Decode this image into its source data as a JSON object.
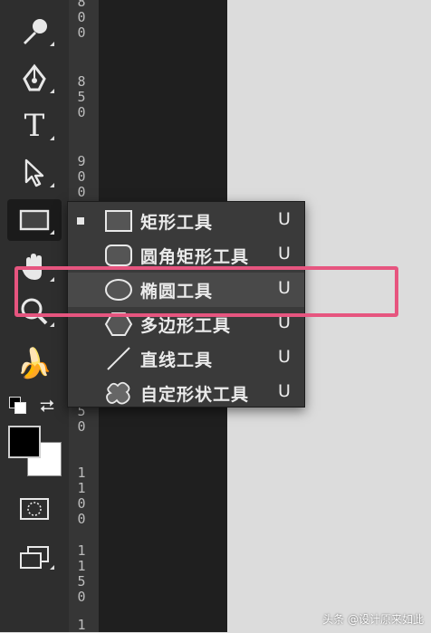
{
  "toolbar": {
    "tools": [
      {
        "name": "eyedropper-tool",
        "icon": "eyedropper-icon"
      },
      {
        "name": "pen-tool",
        "icon": "pen-icon"
      },
      {
        "name": "type-tool",
        "icon": "type-icon",
        "glyph": "T"
      },
      {
        "name": "path-selection-tool",
        "icon": "arrow-cursor-icon"
      },
      {
        "name": "rectangle-tool",
        "icon": "rectangle-icon",
        "active": true
      },
      {
        "name": "hand-tool",
        "icon": "hand-icon"
      },
      {
        "name": "zoom-tool",
        "icon": "magnifier-icon"
      },
      {
        "name": "banana-tool",
        "icon": "banana-icon",
        "glyph": "🍌"
      }
    ],
    "foreground_color": "#000000",
    "background_color": "#ffffff"
  },
  "ruler": {
    "labels": [
      "8\n0\n0",
      "8\n5\n0",
      "9\n0\n0",
      "1\n0\n0\n0",
      "1\n1\n0\n0",
      "1\n1\n5\n0",
      "1"
    ]
  },
  "flyout": {
    "items": [
      {
        "label": "矩形工具",
        "shortcut": "U",
        "icon": "rectangle-icon",
        "checked": true
      },
      {
        "label": "圆角矩形工具",
        "shortcut": "U",
        "icon": "rounded-rectangle-icon"
      },
      {
        "label": "椭圆工具",
        "shortcut": "U",
        "icon": "ellipse-icon",
        "highlighted": true
      },
      {
        "label": "多边形工具",
        "shortcut": "U",
        "icon": "polygon-icon"
      },
      {
        "label": "直线工具",
        "shortcut": "U",
        "icon": "line-icon"
      },
      {
        "label": "自定形状工具",
        "shortcut": "U",
        "icon": "custom-shape-icon"
      }
    ]
  },
  "annotation": {
    "color": "#e6557f"
  },
  "watermark": "头条 @设计原来如此"
}
